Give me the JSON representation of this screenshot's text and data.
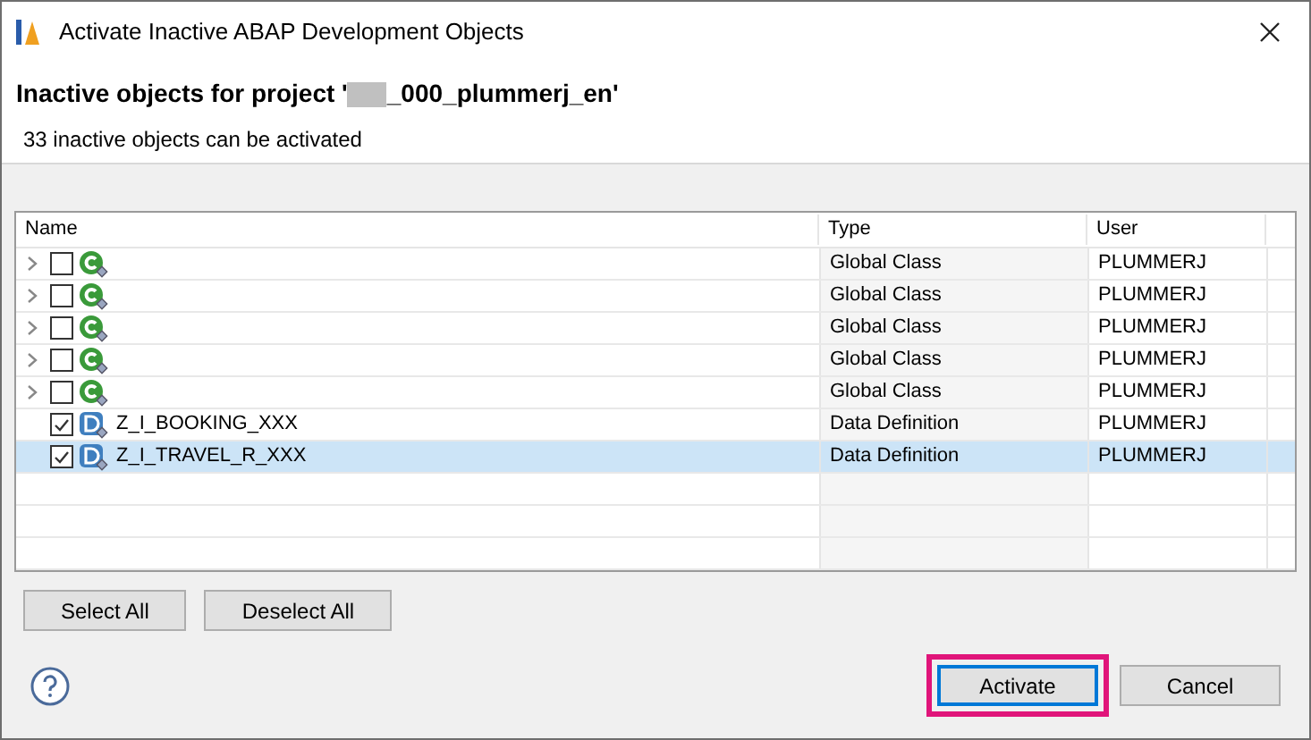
{
  "window": {
    "title": "Activate Inactive ABAP Development Objects"
  },
  "header": {
    "title_prefix": "Inactive objects for project '",
    "title_suffix": "_000_plummerj_en'",
    "subtitle": "33 inactive objects can be activated"
  },
  "table": {
    "columns": [
      "Name",
      "Type",
      "User"
    ],
    "rows": [
      {
        "kind": "class",
        "expandable": true,
        "checked": false,
        "selected": false,
        "type": "Global Class",
        "user": "PLUMMERJ"
      },
      {
        "kind": "class",
        "expandable": true,
        "checked": false,
        "selected": false,
        "type": "Global Class",
        "user": "PLUMMERJ"
      },
      {
        "kind": "class",
        "expandable": true,
        "checked": false,
        "selected": false,
        "type": "Global Class",
        "user": "PLUMMERJ"
      },
      {
        "kind": "class",
        "expandable": true,
        "checked": false,
        "selected": false,
        "type": "Global Class",
        "user": "PLUMMERJ"
      },
      {
        "kind": "class",
        "expandable": true,
        "checked": false,
        "selected": false,
        "type": "Global Class",
        "user": "PLUMMERJ"
      },
      {
        "kind": "ddl",
        "expandable": false,
        "checked": true,
        "selected": false,
        "name": "Z_I_BOOKING_XXX",
        "type": "Data Definition",
        "user": "PLUMMERJ"
      },
      {
        "kind": "ddl",
        "expandable": false,
        "checked": true,
        "selected": true,
        "name": "Z_I_TRAVEL_R_XXX",
        "type": "Data Definition",
        "user": "PLUMMERJ"
      }
    ]
  },
  "selection_buttons": [
    "Select All",
    "Deselect All"
  ],
  "buttons": [
    {
      "label": "Activate",
      "highlighted": true
    },
    {
      "label": "Cancel",
      "highlighted": false
    }
  ]
}
